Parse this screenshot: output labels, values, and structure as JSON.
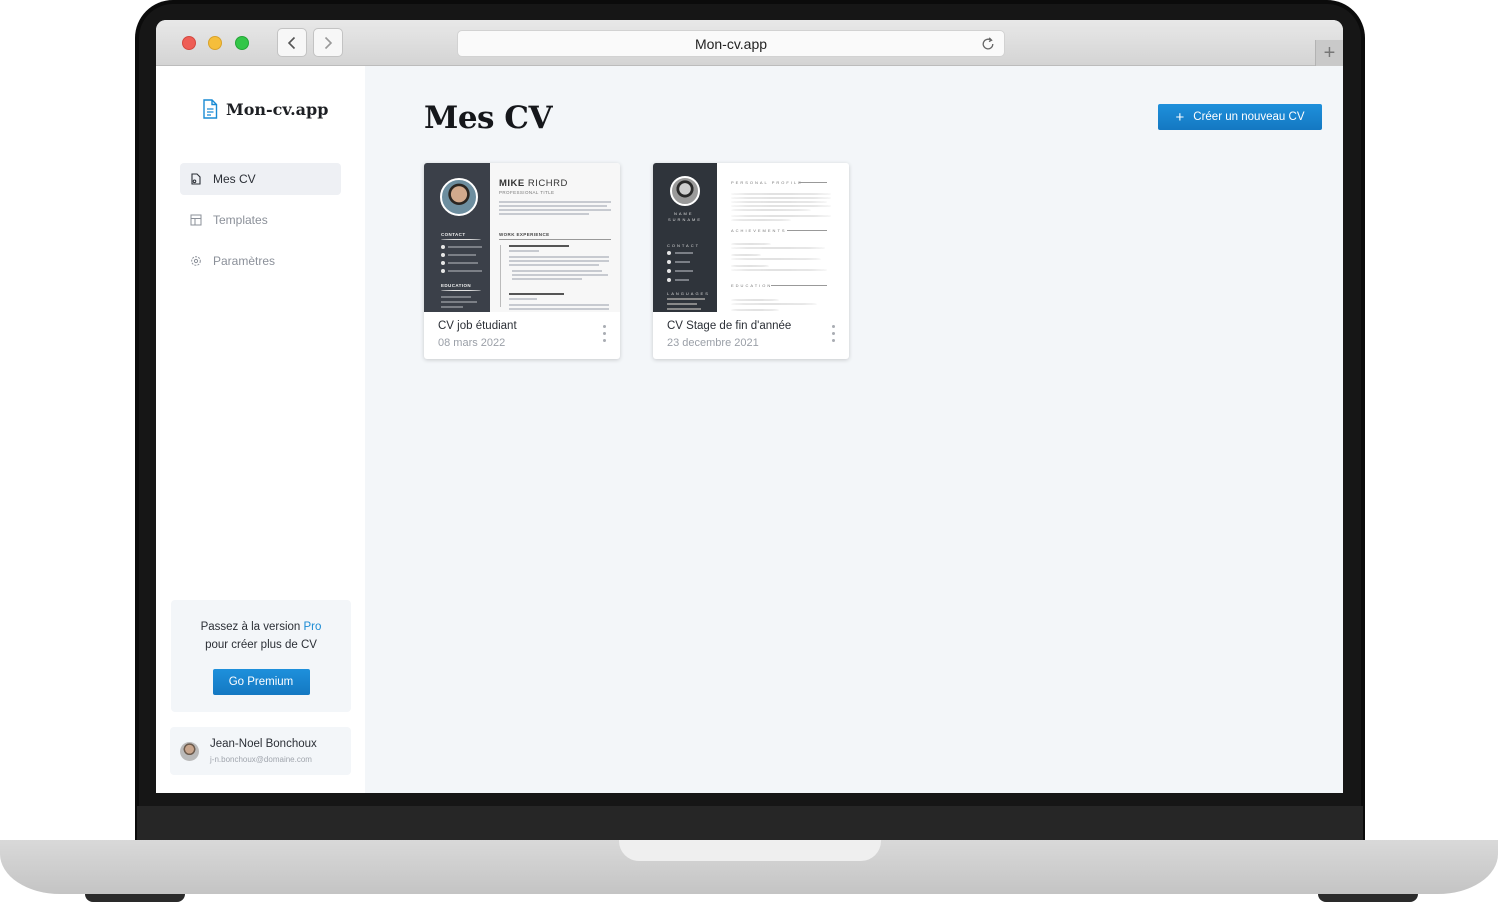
{
  "browser": {
    "url": "Mon-cv.app"
  },
  "sidebar": {
    "logo": "Mon-cv.app",
    "items": [
      {
        "label": "Mes CV",
        "icon": "document-icon",
        "active": true
      },
      {
        "label": "Templates",
        "icon": "layout-icon",
        "active": false
      },
      {
        "label": "Paramètres",
        "icon": "gear-icon",
        "active": false
      }
    ],
    "promo": {
      "line1_prefix": "Passez à la version",
      "line1_highlight": "Pro",
      "line2": "pour créer plus de CV",
      "button": "Go Premium"
    },
    "user": {
      "name": "Jean-Noel Bonchoux",
      "email": "j-n.bonchoux@domaine.com"
    }
  },
  "main": {
    "title": "Mes CV",
    "create_button": "Créer un nouveau CV",
    "cards": [
      {
        "title": "CV job étudiant",
        "date": "08 mars 2022",
        "thumb": {
          "first_name": "MIKE",
          "last_name": "RICHRD",
          "subtitle": "PROFESSIONAL TITLE",
          "contact": "CONTACT",
          "education": "EDUCATION",
          "work": "WORK EXPERIENCE"
        }
      },
      {
        "title": "CV Stage de fin d'année",
        "date": "23 decembre 2021",
        "thumb": {
          "name": "NAME",
          "surname": "SURNAME",
          "contact": "CONTACT",
          "languages": "LANGUAGES",
          "profile": "PERSONAL PROFILE",
          "achievements": "ACHIEVEMENTS",
          "education": "EDUCATION"
        }
      }
    ]
  },
  "colors": {
    "accent": "#1a8bd4",
    "background": "#f3f6f9",
    "sidebar": "#ffffff",
    "title": "#15171b"
  }
}
